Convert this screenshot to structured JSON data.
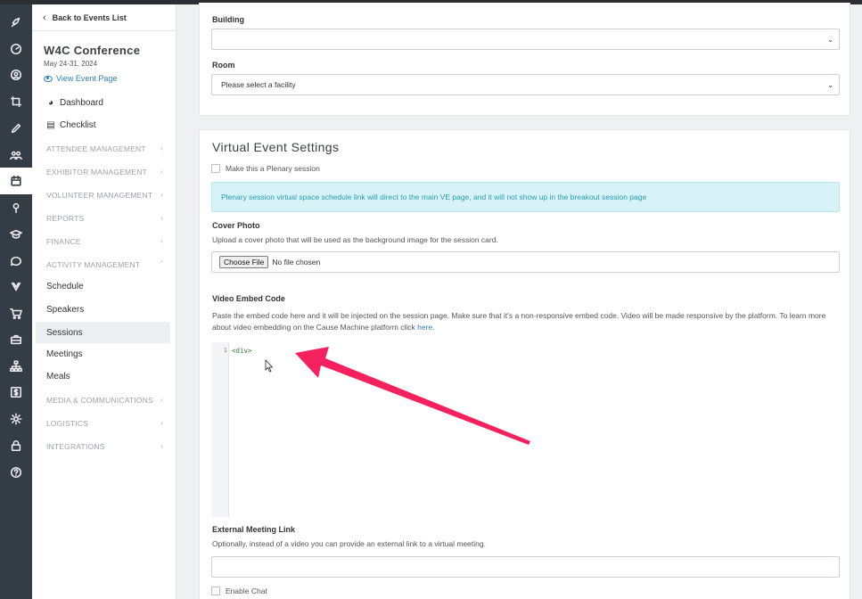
{
  "sidebar": {
    "back_label": "Back to Events List",
    "event_title": "W4C Conference",
    "event_dates": "May 24-31, 2024",
    "view_event_page": "View Event Page",
    "items": [
      {
        "label": "Dashboard",
        "icon": "dashboard-icon"
      },
      {
        "label": "Checklist",
        "icon": "clipboard-icon"
      }
    ],
    "sections": [
      "ATTENDEE MANAGEMENT",
      "EXHIBITOR MANAGEMENT",
      "VOLUNTEER MANAGEMENT",
      "REPORTS",
      "FINANCE",
      "ACTIVITY MANAGEMENT"
    ],
    "activity_items": [
      "Schedule",
      "Speakers",
      "Sessions",
      "Meetings",
      "Meals"
    ],
    "active_item": "Sessions",
    "lower_sections": [
      "MEDIA & COMMUNICATIONS",
      "LOGISTICS",
      "INTEGRATIONS"
    ]
  },
  "rail_icons": [
    "rocket-icon",
    "gauge-icon",
    "user-circle-icon",
    "crop-icon",
    "pencil-icon",
    "users-icon",
    "calendar-icon",
    "map-pin-icon",
    "graduation-cap-icon",
    "chat-icon",
    "ribbon-icon",
    "cart-icon",
    "briefcase-icon",
    "sitemap-icon",
    "dollar-icon",
    "gear-icon",
    "lock-icon",
    "help-icon"
  ],
  "location": {
    "building_label": "Building",
    "building_value": "",
    "room_label": "Room",
    "room_value": "Please select a facility"
  },
  "virtual": {
    "title": "Virtual Event Settings",
    "plenary_label": "Make this a Plenary session",
    "plenary_note": "Plenary session virtual space schedule link will direct to the main VE page, and it will not show up in the breakout session page",
    "cover_label": "Cover Photo",
    "cover_help": "Upload a cover photo that will be used as the background image for the session card.",
    "choose_file": "Choose File",
    "no_file": "No file chosen",
    "video_label": "Video Embed Code",
    "video_help": "Paste the embed code here and it will be injected on the session page. Make sure that it's a non-responsive embed code. Video will be made responsive by the platform. To learn more about video embedding on the Cause Machine platform click",
    "video_help_link": "here",
    "code_line_number": "1",
    "code_content": "<div>",
    "meeting_label": "External Meeting Link",
    "meeting_help": "Optionally, instead of a video you can provide an external link to a virtual meeting.",
    "meeting_value": "",
    "enable_chat_label": "Enable Chat"
  },
  "annotation": {
    "color": "#f5215f"
  }
}
